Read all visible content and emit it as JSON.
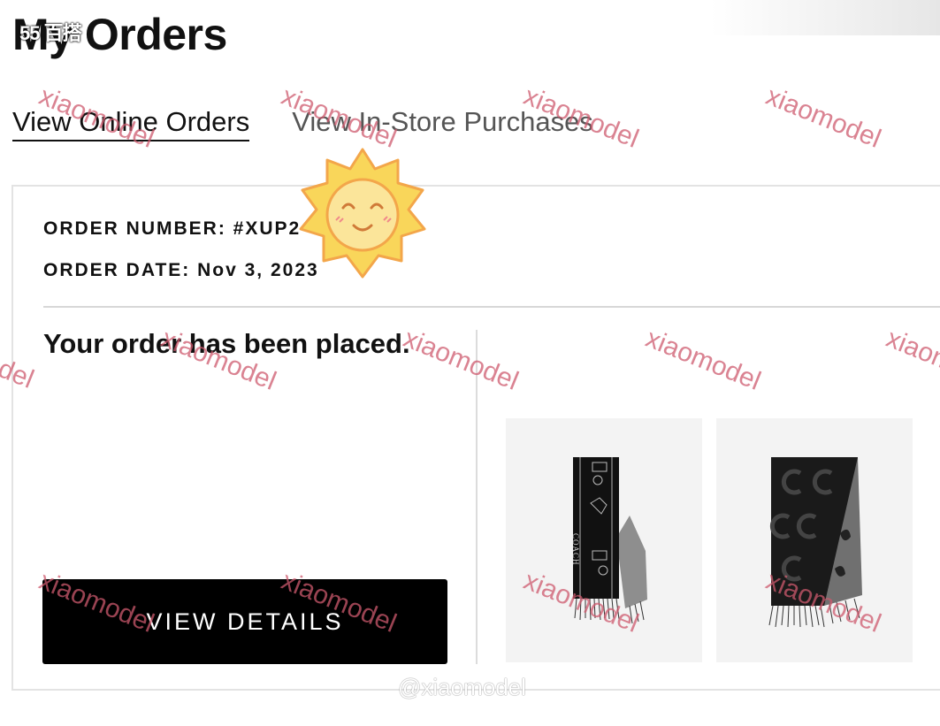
{
  "page": {
    "title": "My Orders",
    "title_overlay": "55 百搭"
  },
  "tabs": [
    {
      "label": "View Online Orders",
      "active": true
    },
    {
      "label": "View In-Store Purchases",
      "active": false
    }
  ],
  "order": {
    "number_label": "ORDER NUMBER: #XUP2",
    "date_label": "ORDER DATE: Nov 3, 2023",
    "status": "Your order has been placed.",
    "details_button": "VIEW DETAILS",
    "products": [
      {
        "name": "black horse and carriage scarf",
        "brand_mark": "COACH"
      },
      {
        "name": "black signature jacquard scarf"
      }
    ]
  },
  "overlays": {
    "watermark": "xiaomodel",
    "handle": "@xiaomodel",
    "sticker": "smiling-sun-sticker"
  },
  "colors": {
    "accent": "#000000",
    "watermark": "#cd5a6e",
    "divider": "#d7d7d7"
  }
}
